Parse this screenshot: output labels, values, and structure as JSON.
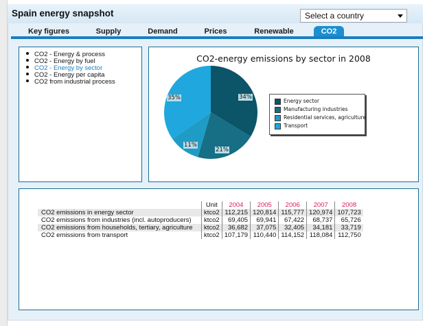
{
  "header": {
    "title": "Spain energy snapshot",
    "country_select_label": "Select a country"
  },
  "tabs": [
    {
      "label": "Key figures"
    },
    {
      "label": "Supply"
    },
    {
      "label": "Demand"
    },
    {
      "label": "Prices"
    },
    {
      "label": "Renewable"
    },
    {
      "label": "CO2",
      "active": true
    }
  ],
  "sidebar": {
    "items": [
      {
        "label": "CO2 - Energy & process"
      },
      {
        "label": "CO2 - Energy by fuel"
      },
      {
        "label": "CO2 - Energy by sector",
        "selected": true
      },
      {
        "label": "CO2 - Energy per capita"
      },
      {
        "label": "CO2 from industrial process"
      }
    ]
  },
  "chart_data": {
    "type": "pie",
    "title": "CO2-energy emissions by sector in 2008",
    "categories": [
      "Energy sector",
      "Manufacturing industries",
      "Residential services, agriculture",
      "Transport"
    ],
    "values": [
      34,
      21,
      11,
      35
    ],
    "labels": [
      "34%",
      "21%",
      "11%",
      "35%"
    ],
    "colors": [
      "#0c5468",
      "#166f84",
      "#1f9cc5",
      "#1fa7de"
    ],
    "legend_position": "right"
  },
  "table": {
    "unit_header": "Unit",
    "years": [
      "2004",
      "2005",
      "2006",
      "2007",
      "2008"
    ],
    "rows": [
      {
        "label": "CO2 emissions in energy sector",
        "unit": "ktco2",
        "values": [
          "112,215",
          "120,814",
          "115,777",
          "120,974",
          "107,723"
        ]
      },
      {
        "label": "CO2 emissions from industries (incl. autoproducers)",
        "unit": "ktco2",
        "values": [
          "69,405",
          "69,941",
          "67,422",
          "68,737",
          "65,726"
        ]
      },
      {
        "label": "CO2 emissions from households, tertiary, agriculture",
        "unit": "ktco2",
        "values": [
          "36,682",
          "37,075",
          "32,405",
          "34,181",
          "33,719"
        ]
      },
      {
        "label": "CO2 emissions from transport",
        "unit": "ktco2",
        "values": [
          "107,179",
          "110,440",
          "114,152",
          "118,084",
          "112,750"
        ]
      }
    ]
  }
}
